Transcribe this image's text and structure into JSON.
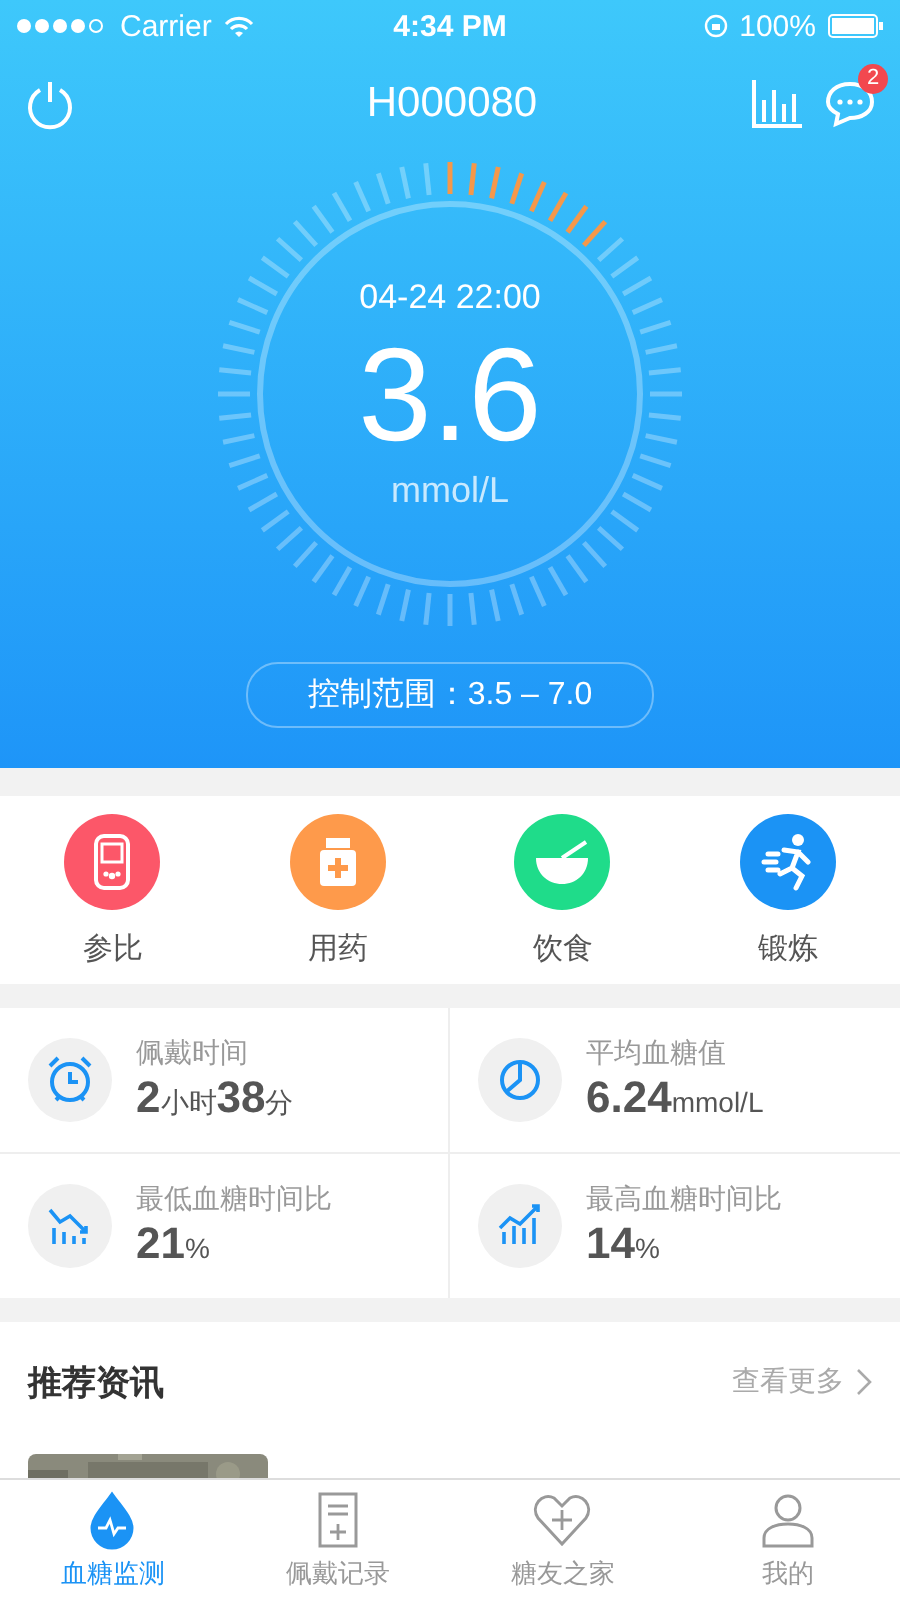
{
  "status_bar": {
    "carrier": "Carrier",
    "time": "4:34 PM",
    "battery": "100%"
  },
  "header": {
    "title": "H000080",
    "badge": "2"
  },
  "reading": {
    "datetime": "04-24 22:00",
    "value": "3.6",
    "unit": "mmol/L",
    "range": "控制范围：3.5 – 7.0"
  },
  "shortcuts": [
    {
      "kind": "meter",
      "label": "参比",
      "color": "#fc5769"
    },
    {
      "kind": "medicine",
      "label": "用药",
      "color": "#fe9a4b"
    },
    {
      "kind": "food",
      "label": "饮食",
      "color": "#1fdc8a"
    },
    {
      "kind": "exercise",
      "label": "锻炼",
      "color": "#1b93f5"
    }
  ],
  "stats": [
    {
      "kind": "clock",
      "label": "佩戴时间",
      "parts": [
        {
          "kind": "number",
          "text": "2"
        },
        {
          "kind": "unit",
          "text": "小时"
        },
        {
          "kind": "number",
          "text": "38"
        },
        {
          "kind": "unit",
          "text": "分"
        }
      ]
    },
    {
      "kind": "pie",
      "label": "平均血糖值",
      "parts": [
        {
          "kind": "number",
          "text": "6.24"
        },
        {
          "kind": "unit",
          "text": "mmol/L"
        }
      ]
    },
    {
      "kind": "down",
      "label": "最低血糖时间比",
      "parts": [
        {
          "kind": "number",
          "text": "21"
        },
        {
          "kind": "unit",
          "text": "%"
        }
      ]
    },
    {
      "kind": "up",
      "label": "最高血糖时间比",
      "parts": [
        {
          "kind": "number",
          "text": "14"
        },
        {
          "kind": "unit",
          "text": "%"
        }
      ]
    }
  ],
  "news": {
    "title": "推荐资讯",
    "more": "查看更多"
  },
  "tabs": [
    {
      "kind": "drop",
      "label": "血糖监测",
      "selected": true
    },
    {
      "kind": "record",
      "label": "佩戴记录",
      "selected": false
    },
    {
      "kind": "heart",
      "label": "糖友之家",
      "selected": false
    },
    {
      "kind": "person",
      "label": "我的",
      "selected": false
    }
  ]
}
